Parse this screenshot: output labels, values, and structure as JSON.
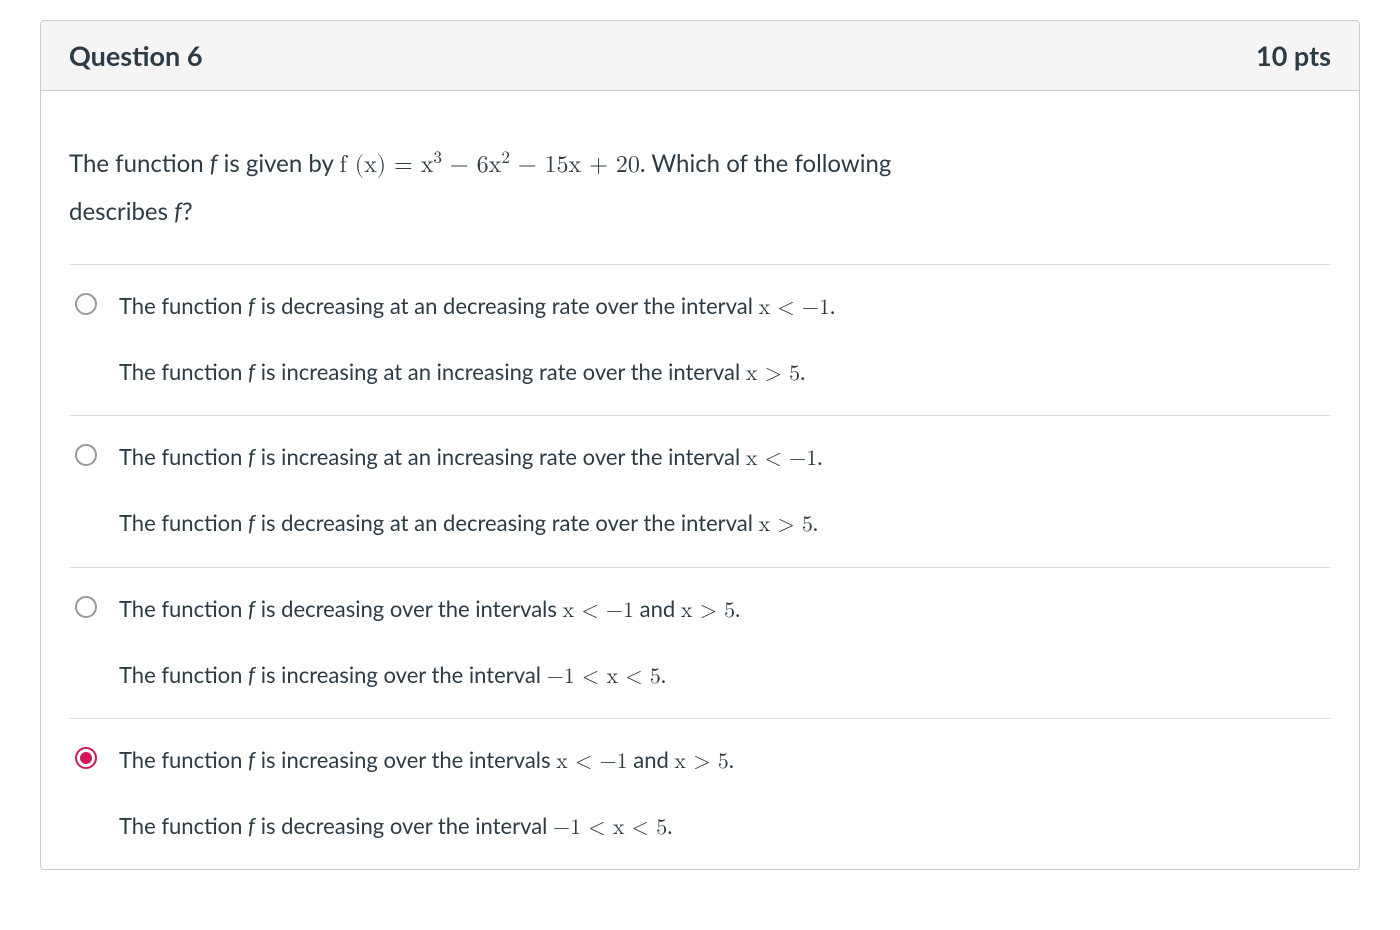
{
  "header": {
    "title": "Question 6",
    "points": "10 pts"
  },
  "prompt": {
    "lead": "The function ",
    "fvar": "f",
    "given": " is given by ",
    "fx": "f (x) = x",
    "e1": "3",
    "t1": " − 6x",
    "e2": "2",
    "t2": " − 15x + 20",
    "tail1": ". Which of the following",
    "tail2": "describes ",
    "fvar2": "f",
    "q": "?"
  },
  "options": [
    {
      "selected": false,
      "l1a": "The function ",
      "l1b": " is decreasing at an decreasing rate over the interval ",
      "l1c": "x < −1",
      "l2a": "The function ",
      "l2b": " is increasing at an increasing rate over the interval ",
      "l2c": "x > 5"
    },
    {
      "selected": false,
      "l1a": "The function ",
      "l1b": " is increasing at an increasing rate over the interval ",
      "l1c": "x < −1",
      "l2a": "The function ",
      "l2b": " is decreasing at an decreasing rate over the interval ",
      "l2c": "x > 5"
    },
    {
      "selected": false,
      "l1a": "The function ",
      "l1b": " is decreasing over the intervals ",
      "l1c": "x < −1",
      "l1d": " and ",
      "l1e": "x > 5",
      "l2a": "The function ",
      "l2b": " is increasing over the interval ",
      "l2c": "−1 < x < 5"
    },
    {
      "selected": true,
      "l1a": "The function ",
      "l1b": " is increasing over the intervals ",
      "l1c": "x < −1",
      "l1d": " and ",
      "l1e": "x > 5",
      "l2a": "The function ",
      "l2b": " is decreasing over the interval ",
      "l2c": "−1 < x < 5"
    }
  ],
  "f_italic": "f"
}
